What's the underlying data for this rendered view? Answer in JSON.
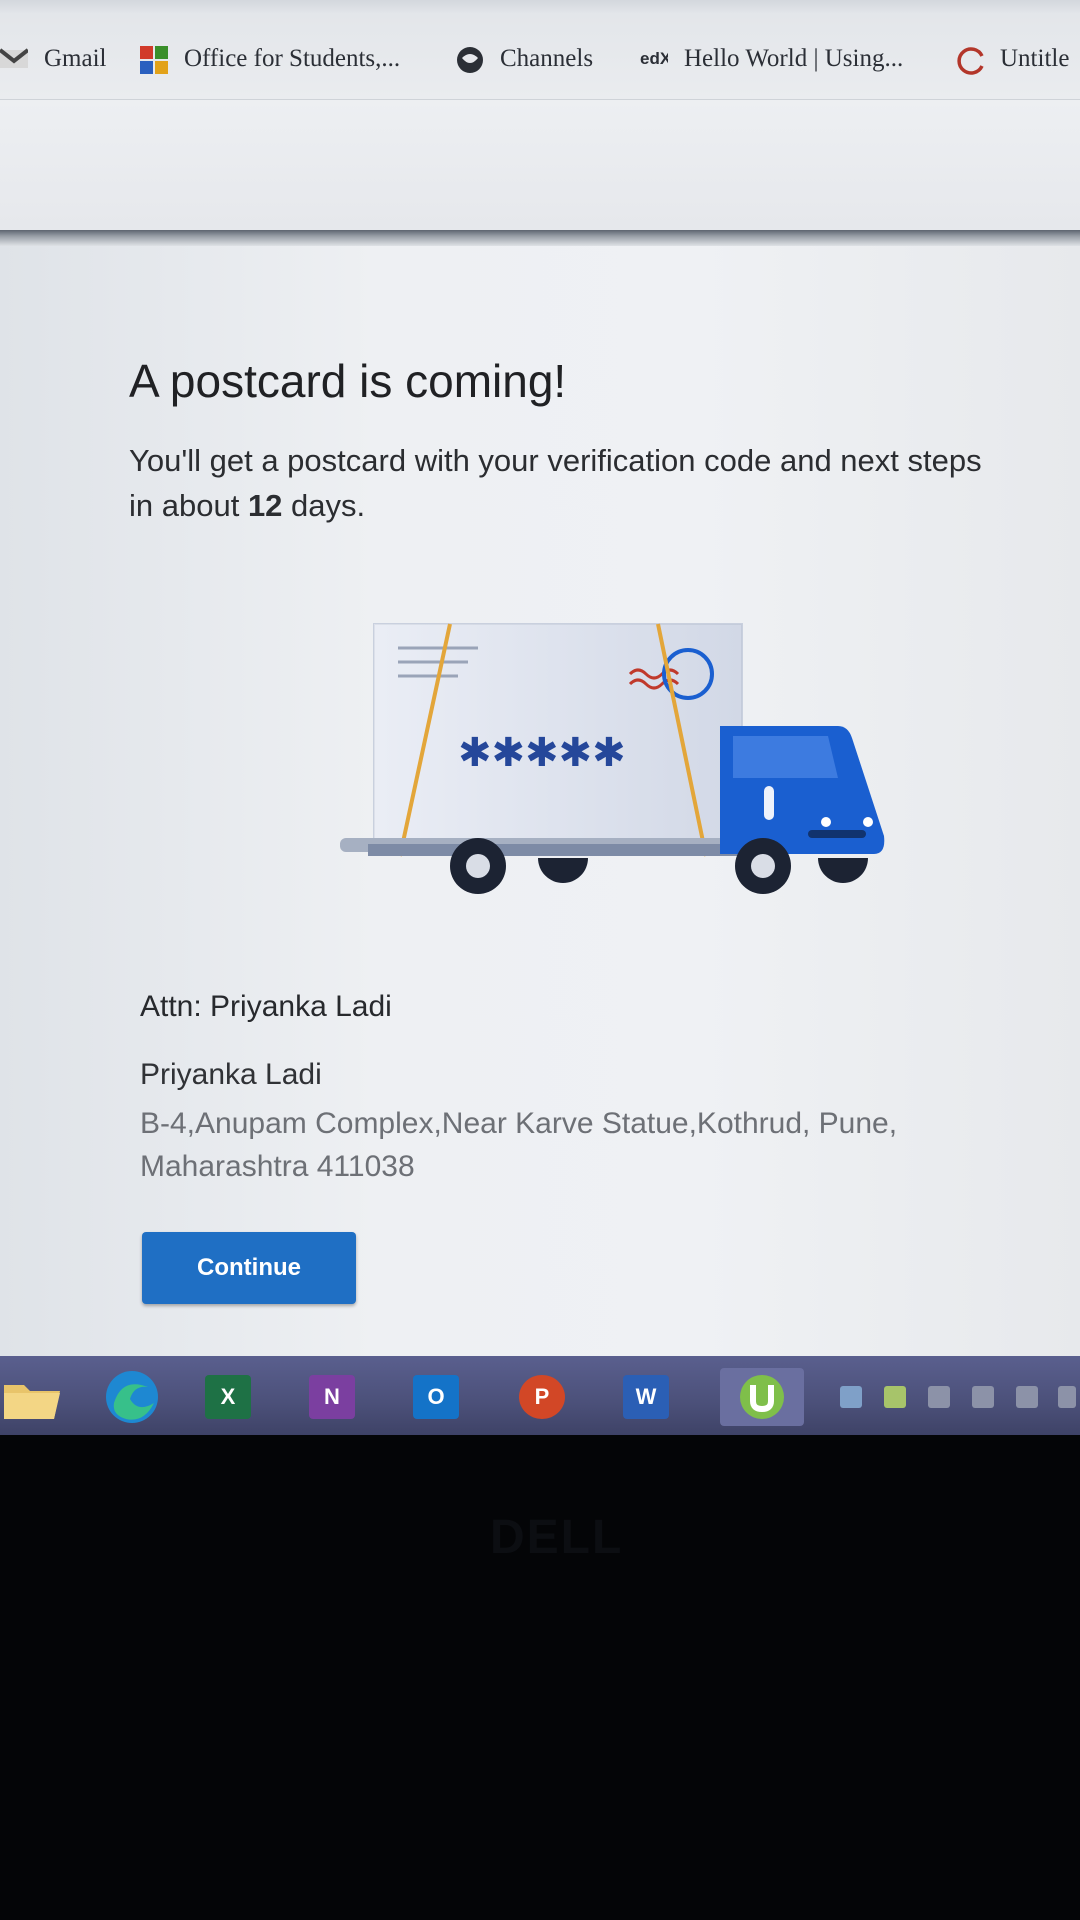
{
  "bookmarks": {
    "items": [
      {
        "label": "Gmail",
        "icon": "gmail-icon"
      },
      {
        "label": "Office for Students,...",
        "icon": "office-icon"
      },
      {
        "label": "Channels",
        "icon": "channels-icon"
      },
      {
        "label": "Hello World | Using...",
        "icon": "edx-icon"
      },
      {
        "label": "Untitle",
        "icon": "loading-icon"
      }
    ]
  },
  "main": {
    "title": "A postcard is coming!",
    "subtitle_before": "You'll get a postcard with your verification code and next steps in about ",
    "subtitle_days": "12",
    "subtitle_after": " days.",
    "illustration": {
      "code_mask": "✱✱✱✱✱",
      "icon": "postcard-truck-icon"
    },
    "attn": "Attn: Priyanka Ladi",
    "recipient_name": "Priyanka Ladi",
    "address": "B-4,Anupam Complex,Near Karve Statue,Kothrud, Pune, Maharashtra 411038",
    "continue_label": "Continue"
  },
  "taskbar": {
    "apps": [
      {
        "name": "file-explorer-icon",
        "letter": ""
      },
      {
        "name": "edge-icon",
        "letter": ""
      },
      {
        "name": "excel-icon",
        "letter": "X"
      },
      {
        "name": "onenote-icon",
        "letter": "N"
      },
      {
        "name": "outlook-icon",
        "letter": "O"
      },
      {
        "name": "powerpoint-icon",
        "letter": "P"
      },
      {
        "name": "word-icon",
        "letter": "W"
      },
      {
        "name": "utorrent-icon",
        "letter": ""
      }
    ]
  },
  "bezel": {
    "brand": "DELL"
  },
  "colors": {
    "accent": "#1f6fc4",
    "truck_blue": "#1a5fd0",
    "stamp_red": "#c0392b"
  }
}
